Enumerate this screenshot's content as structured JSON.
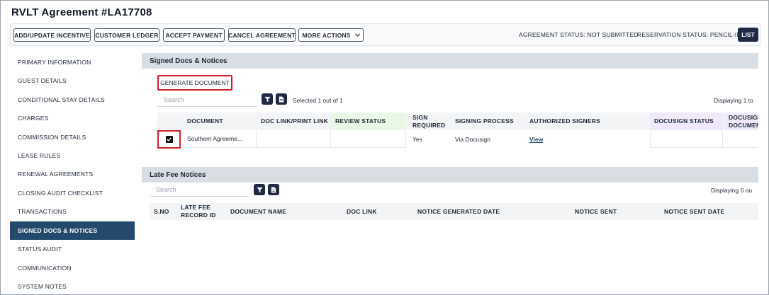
{
  "page": {
    "title": "RVLT Agreement #LA17708"
  },
  "toolbar": {
    "add_update_incentive": "ADD/UPDATE INCENTIVE",
    "customer_ledger": "CUSTOMER LEDGER",
    "accept_payment": "ACCEPT PAYMENT",
    "cancel_agreement": "CANCEL AGREEMENT",
    "more_actions": "MORE ACTIONS",
    "agreement_status": "AGREEMENT STATUS: NOT SUBMITTED",
    "reservation_status": "RESERVATION STATUS: PENCIL-IN",
    "list": "LIST"
  },
  "sidebar": {
    "items": [
      {
        "label": "PRIMARY INFORMATION"
      },
      {
        "label": "GUEST DETAILS"
      },
      {
        "label": "CONDITIONAL STAY DETAILS"
      },
      {
        "label": "CHARGES"
      },
      {
        "label": "COMMISSION DETAILS"
      },
      {
        "label": "LEASE RULES"
      },
      {
        "label": "RENEWAL AGREEMENTS"
      },
      {
        "label": "CLOSING AUDIT CHECKLIST"
      },
      {
        "label": "TRANSACTIONS"
      },
      {
        "label": "SIGNED DOCS & NOTICES"
      },
      {
        "label": "STATUS AUDIT"
      },
      {
        "label": "COMMUNICATION"
      },
      {
        "label": "SYSTEM NOTES"
      }
    ],
    "active_index": 9
  },
  "signed_docs": {
    "title": "Signed Docs & Notices",
    "generate_button": "GENERATE DOCUMENT",
    "search_placeholder": "Search",
    "selected_text": "Selected 1 out of 1",
    "displaying_text": "Displaying 1 to",
    "columns": {
      "document": "DOCUMENT",
      "doc_link": "DOC LINK/PRINT LINK",
      "review_status": "REVIEW STATUS",
      "sign_required": "SIGN REQUIRED",
      "signing_process": "SIGNING PROCESS",
      "authorized_signers": "AUTHORIZED SIGNERS",
      "docusign_status": "DOCUSIGN STATUS",
      "docusign_document": "DOCUSIGN DOCUMENT"
    },
    "rows": [
      {
        "document": "Southern Agreeme...",
        "doc_link": "",
        "review_status": "",
        "sign_required": "Yes",
        "signing_process": "Via Docusign",
        "authorized_signers": "View",
        "docusign_status": "",
        "docusign_document": ""
      }
    ]
  },
  "late_fee": {
    "title": "Late Fee Notices",
    "search_placeholder": "Search",
    "displaying_text": "Displaying 0 ou",
    "columns": {
      "sno": "S.NO",
      "record_id": "LATE FEE RECORD ID",
      "document_name": "DOCUMENT NAME",
      "doc_link": "DOC LINK",
      "notice_generated_date": "NOTICE GENERATED DATE",
      "notice_sent": "NOTICE SENT",
      "notice_sent_date": "NOTICE SENT DATE"
    }
  },
  "colors": {
    "accent_navy": "#1f2a44",
    "sidebar_active": "#234a6c",
    "highlight_red": "#d11f2a",
    "review_status_header_bg": "#e9f7e6",
    "docusign_header_bg": "#efe9fb"
  }
}
